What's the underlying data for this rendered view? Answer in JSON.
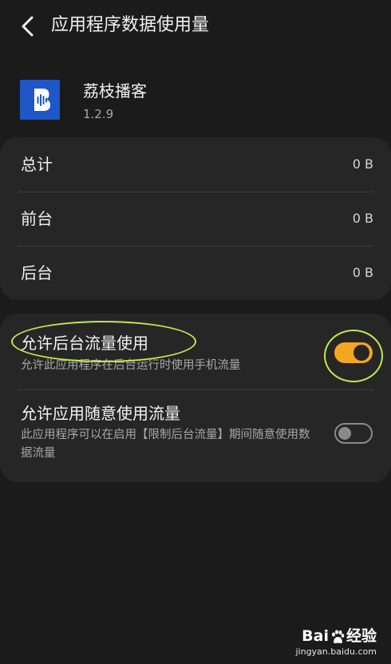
{
  "header": {
    "back_icon": "chevron-left-icon",
    "title": "应用程序数据使用量"
  },
  "app": {
    "name": "荔枝播客",
    "version": "1.2.9",
    "icon_color": "#1f57c7"
  },
  "usage": {
    "rows": [
      {
        "label": "总计",
        "value": "0 B"
      },
      {
        "label": "前台",
        "value": "0 B"
      },
      {
        "label": "后台",
        "value": "0 B"
      }
    ]
  },
  "settings": {
    "background_data": {
      "title": "允许后台流量使用",
      "description": "允许此应用程序在后台运行时使用手机流量",
      "enabled": true
    },
    "unrestricted_data": {
      "title": "允许应用随意使用流量",
      "description": "此应用程序可以在启用【限制后台流量】期间随意使用数据流量",
      "enabled": false
    }
  },
  "colors": {
    "background": "#1b1b1b",
    "card": "#262626",
    "toggle_on": "#f3a620",
    "annotation": "#c6e64b"
  },
  "watermark": {
    "brand_prefix": "Bai",
    "brand_suffix": "经验",
    "url": "jingyan.baidu.com"
  }
}
